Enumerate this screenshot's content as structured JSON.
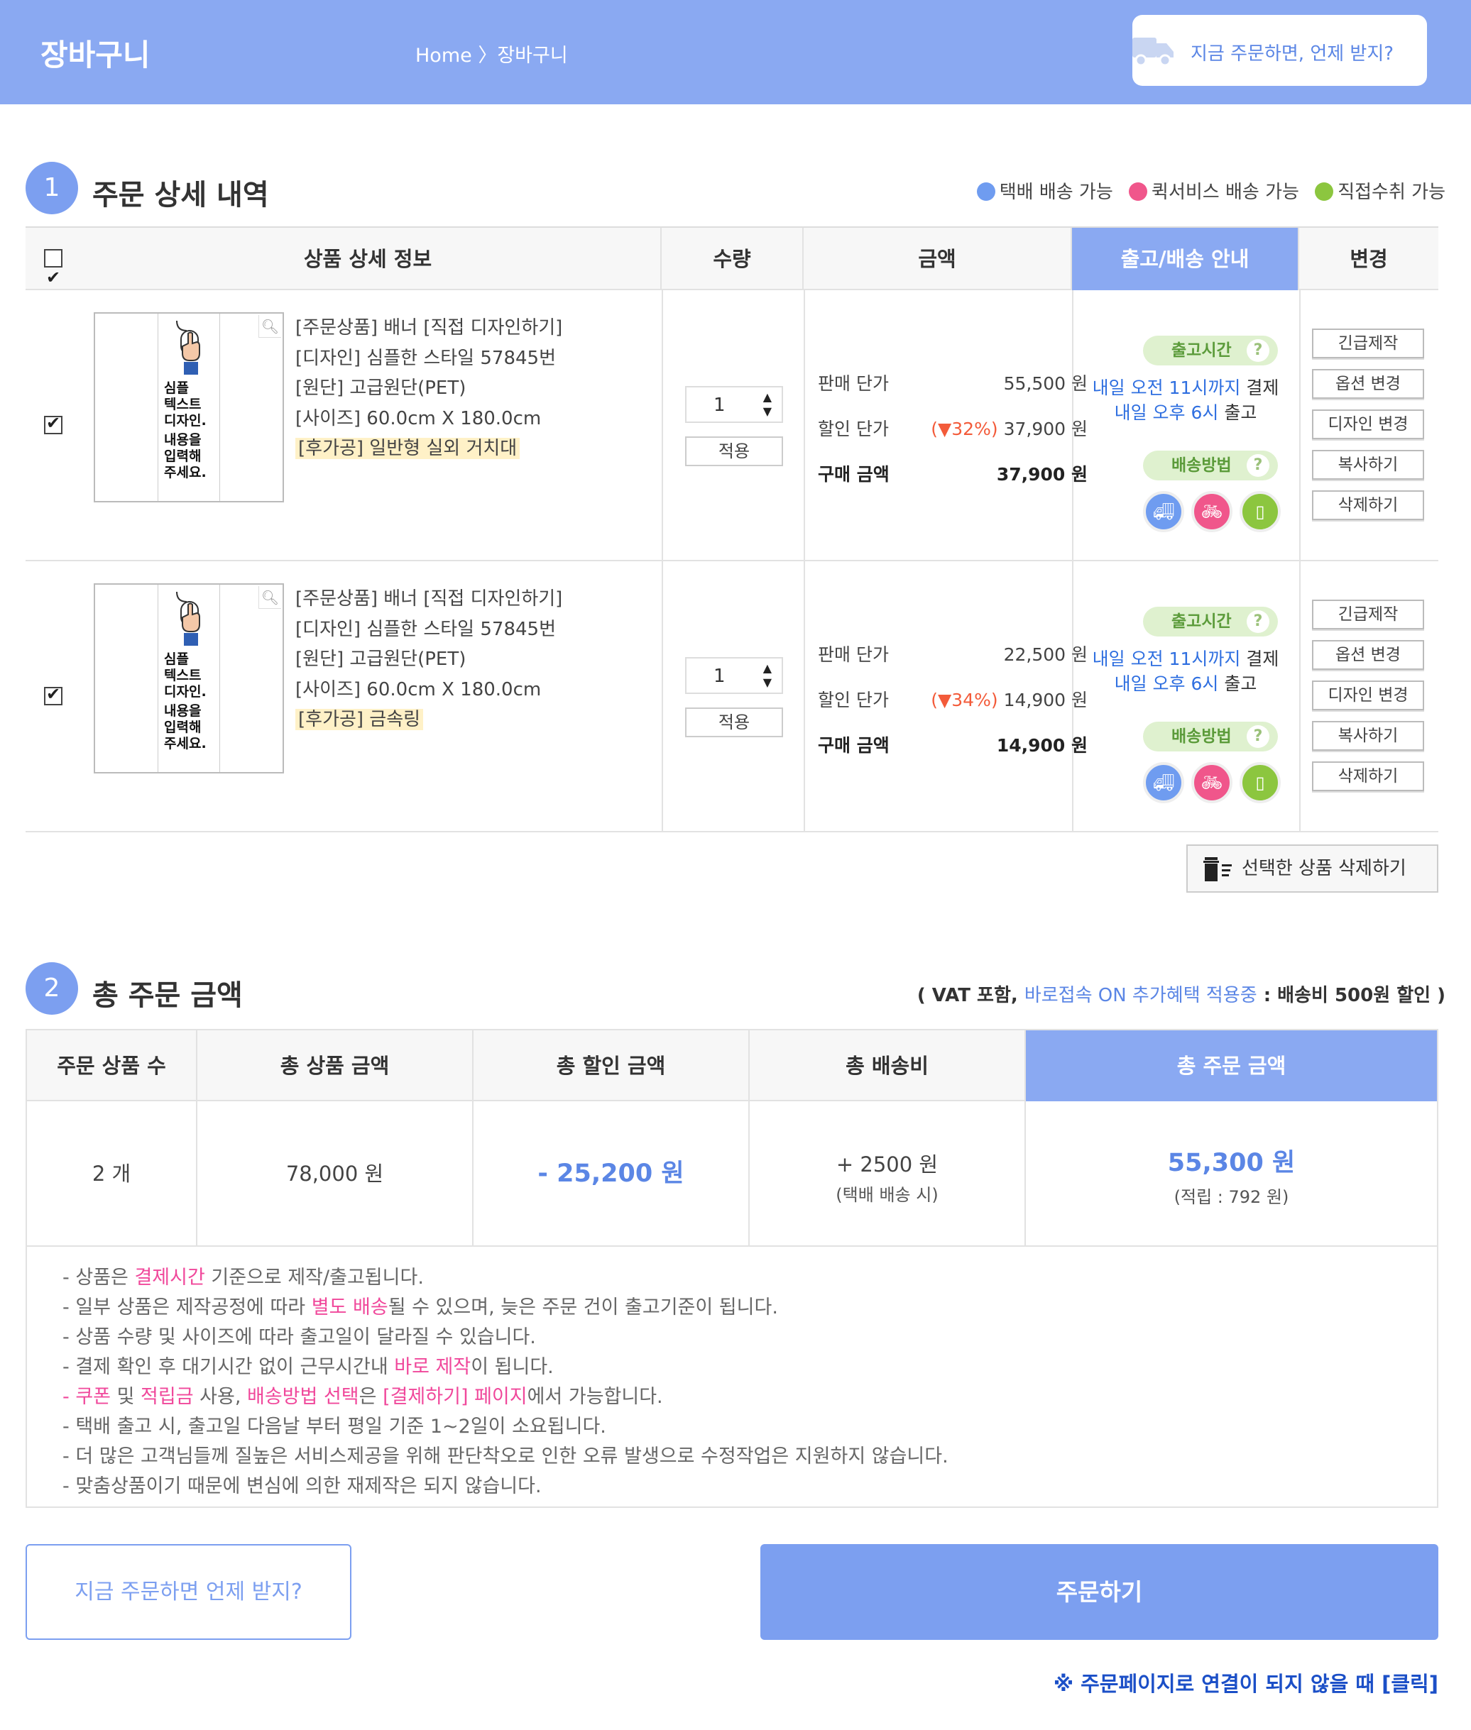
{
  "header": {
    "title": "장바구니",
    "breadcrumb": "Home 〉장바구니",
    "when_label": "지금 주문하면, 언제 받지?"
  },
  "section1": {
    "num": "1",
    "title": "주문 상세 내역",
    "legend": [
      {
        "label": "택배 배송 가능",
        "color": "#6f9cf0"
      },
      {
        "label": "퀵서비스 배송 가능",
        "color": "#f0568b"
      },
      {
        "label": "직접수취 가능",
        "color": "#8cc63f"
      }
    ],
    "columns": {
      "info": "상품 상세 정보",
      "qty": "수량",
      "amount": "금액",
      "ship": "출고/배송 안내",
      "change": "변경"
    }
  },
  "thumb": {
    "text": [
      "심플",
      "텍스트",
      "디자인.",
      "내용을",
      "입력해",
      "주세요."
    ]
  },
  "items": [
    {
      "info": [
        "[주문상품] 배너 [직접 디자인하기]",
        "[디자인] 심플한 스타일 57845번",
        "[원단] 고급원단(PET)",
        "[사이즈] 60.0cm X 180.0cm"
      ],
      "post": "[후가공] 일반형 실외 거치대",
      "qty": "1",
      "apply": "적용",
      "sale_label": "판매 단가",
      "sale_price": "55,500 원",
      "disc_label": "할인 단가",
      "disc_rate": "(▼32%)",
      "disc_price": "37,900 원",
      "buy_label": "구매 금액",
      "buy_price": "37,900 원",
      "ship_time_label": "출고시간",
      "ship_line1_blue": "내일 오전 11시까지",
      "ship_line1_rest": " 결제",
      "ship_line2_blue": "내일 오후 6시",
      "ship_line2_rest": " 출고",
      "ship_method_label": "배송방법",
      "actions": [
        "긴급제작",
        "옵션 변경",
        "디자인 변경",
        "복사하기",
        "삭제하기"
      ]
    },
    {
      "info": [
        "[주문상품] 배너 [직접 디자인하기]",
        "[디자인] 심플한 스타일 57845번",
        "[원단] 고급원단(PET)",
        "[사이즈] 60.0cm X 180.0cm"
      ],
      "post": "[후가공] 금속링",
      "qty": "1",
      "apply": "적용",
      "sale_label": "판매 단가",
      "sale_price": "22,500 원",
      "disc_label": "할인 단가",
      "disc_rate": "(▼34%)",
      "disc_price": "14,900 원",
      "buy_label": "구매 금액",
      "buy_price": "14,900 원",
      "ship_time_label": "출고시간",
      "ship_line1_blue": "내일 오전 11시까지",
      "ship_line1_rest": " 결제",
      "ship_line2_blue": "내일 오후 6시",
      "ship_line2_rest": " 출고",
      "ship_method_label": "배송방법",
      "actions": [
        "긴급제작",
        "옵션 변경",
        "디자인 변경",
        "복사하기",
        "삭제하기"
      ]
    }
  ],
  "delete_selected": "선택한 상품 삭제하기",
  "section2": {
    "num": "2",
    "title": "총 주문 금액",
    "vat_pre": "( VAT 포함, ",
    "vat_blue": "바로접속 ON 추가혜택 적용중",
    "vat_post": " : 배송비 500원 할인 )",
    "headers": [
      "주문 상품 수",
      "총 상품 금액",
      "총 할인 금액",
      "총 배송비",
      "총 주문 금액"
    ],
    "count": "2 개",
    "product_total": "78,000 원",
    "discount_total": "- 25,200 원",
    "shipping": "+ 2500 원",
    "shipping_note": "(택배 배송 시)",
    "order_total": "55,300 원",
    "points": "(적립 : 792 원)"
  },
  "notes": {
    "n1a": "- 상품은 ",
    "n1b": "결제시간",
    "n1c": " 기준으로 제작/출고됩니다.",
    "n2a": "- 일부 상품은 제작공정에 따라 ",
    "n2b": "별도 배송",
    "n2c": "될 수 있으며, 늦은 주문 건이 출고기준이 됩니다.",
    "n3": "- 상품 수량 및 사이즈에 따라 출고일이 달라질 수 있습니다.",
    "n4a": "- 결제 확인 후 대기시간 없이 근무시간내 ",
    "n4b": "바로 제작",
    "n4c": "이 됩니다.",
    "n5a": "- 쿠폰",
    "n5b": " 및 ",
    "n5c": "적립금",
    "n5d": " 사용, ",
    "n5e": "배송방법 선택",
    "n5f": "은 ",
    "n5g": "[결제하기] 페이지",
    "n5h": "에서 가능합니다.",
    "n6": "- 택배 출고 시, 출고일 다음날 부터 평일 기준 1~2일이 소요됩니다.",
    "n7": "- 더 많은 고객님들께 질높은 서비스제공을 위해 판단착오로 인한 오류 발생으로 수정작업은 지원하지 않습니다.",
    "n8": "- 맞춤상품이기 때문에 변심에 의한 재제작은 되지 않습니다."
  },
  "buttons": {
    "when": "지금 주문하면 언제 받지?",
    "order": "주문하기",
    "fallback": "※ 주문페이지로 연결이 되지 않을 때 [클릭]"
  },
  "colors": {
    "accent": "#8aa9f2",
    "pink": "#f0489b",
    "discount_red": "#f35b3a"
  }
}
